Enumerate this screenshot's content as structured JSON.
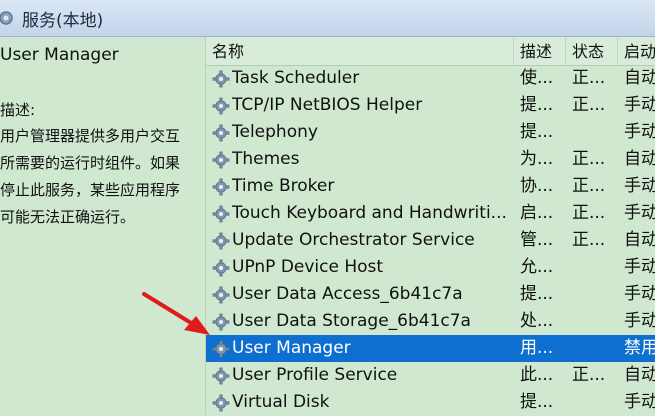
{
  "window": {
    "title": "服务(本地)"
  },
  "left_panel": {
    "service_name": "User Manager",
    "desc_label": "描述:",
    "desc_lines": [
      "用户管理器提供多用户交互",
      "所需要的运行时组件。如果",
      "停止此服务，某些应用程序",
      "可能无法正确运行。"
    ]
  },
  "table": {
    "columns": [
      "名称",
      "描述",
      "状态",
      "启动"
    ],
    "rows": [
      {
        "name": "Task Scheduler",
        "desc": "使...",
        "status": "正...",
        "startup": "自动"
      },
      {
        "name": "TCP/IP NetBIOS Helper",
        "desc": "提...",
        "status": "正...",
        "startup": "手动"
      },
      {
        "name": "Telephony",
        "desc": "提...",
        "status": "",
        "startup": "手动"
      },
      {
        "name": "Themes",
        "desc": "为...",
        "status": "正...",
        "startup": "自动"
      },
      {
        "name": "Time Broker",
        "desc": "协...",
        "status": "正...",
        "startup": "手动"
      },
      {
        "name": "Touch Keyboard and Handwriti...",
        "desc": "启...",
        "status": "正...",
        "startup": "手动"
      },
      {
        "name": "Update Orchestrator Service",
        "desc": "管...",
        "status": "正...",
        "startup": "自动"
      },
      {
        "name": "UPnP Device Host",
        "desc": "允...",
        "status": "",
        "startup": "手动"
      },
      {
        "name": "User Data Access_6b41c7a",
        "desc": "提...",
        "status": "",
        "startup": "手动"
      },
      {
        "name": "User Data Storage_6b41c7a",
        "desc": "处...",
        "status": "",
        "startup": "手动"
      },
      {
        "name": "User Manager",
        "desc": "用...",
        "status": "",
        "startup": "禁用",
        "selected": true
      },
      {
        "name": "User Profile Service",
        "desc": "此...",
        "status": "正...",
        "startup": "自动"
      },
      {
        "name": "Virtual Disk",
        "desc": "提...",
        "status": "",
        "startup": "手动"
      }
    ]
  },
  "colors": {
    "background": "#cfe8cf",
    "selection": "#0f6fd1",
    "arrow": "#e01b1b",
    "gear": "#7f97ad"
  },
  "icons": {
    "title": "services-icon",
    "row": "gear-icon"
  }
}
